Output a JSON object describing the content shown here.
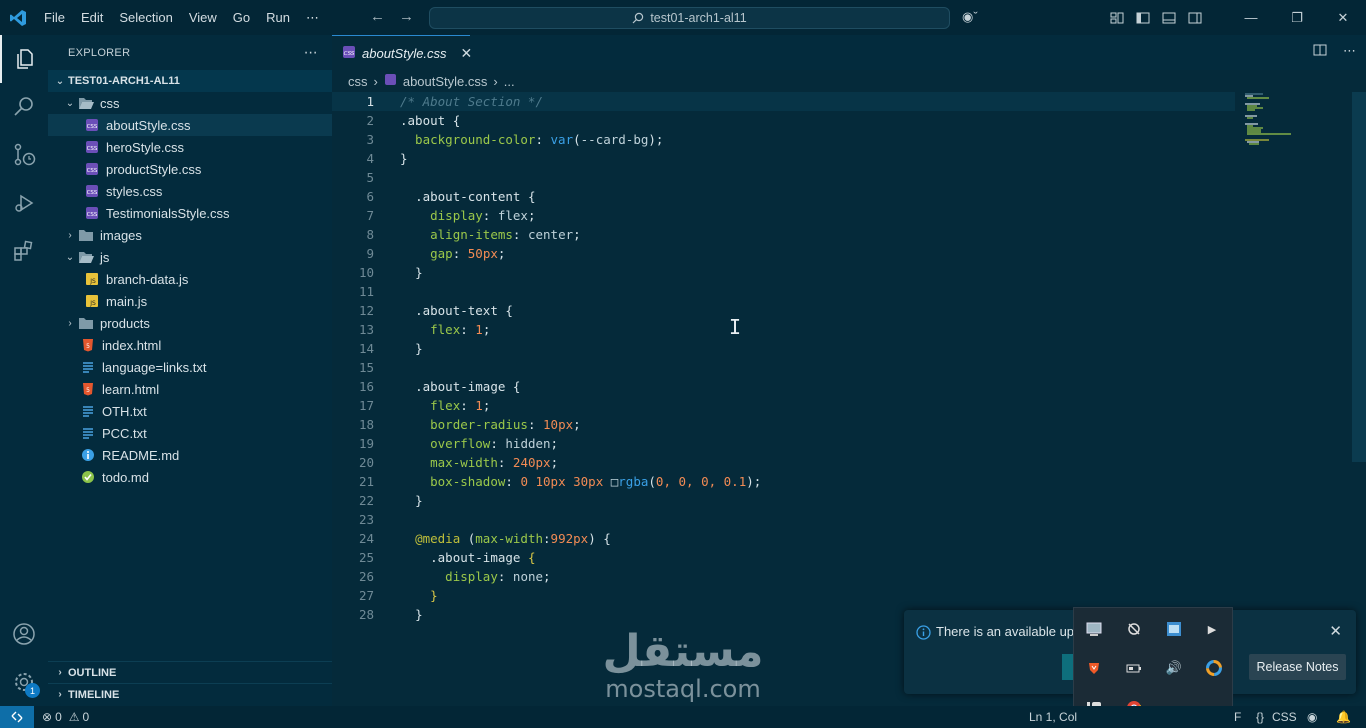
{
  "menu": [
    "File",
    "Edit",
    "Selection",
    "View",
    "Go",
    "Run",
    "⋯"
  ],
  "search": {
    "text": "test01-arch1-al11"
  },
  "sidebar": {
    "title": "EXPLORER",
    "more": "⋯",
    "root": "TEST01-ARCH1-AL11",
    "items": [
      {
        "label": "css",
        "type": "folder-open",
        "depth": 0
      },
      {
        "label": "aboutStyle.css",
        "type": "css",
        "depth": 1
      },
      {
        "label": "heroStyle.css",
        "type": "css",
        "depth": 1
      },
      {
        "label": "productStyle.css",
        "type": "css",
        "depth": 1
      },
      {
        "label": "styles.css",
        "type": "css",
        "depth": 1
      },
      {
        "label": "TestimonialsStyle.css",
        "type": "css",
        "depth": 1
      },
      {
        "label": "images",
        "type": "folder",
        "depth": 0
      },
      {
        "label": "js",
        "type": "folder-open",
        "depth": 0
      },
      {
        "label": "branch-data.js",
        "type": "js",
        "depth": 1
      },
      {
        "label": "main.js",
        "type": "js",
        "depth": 1
      },
      {
        "label": "products",
        "type": "folder",
        "depth": 0
      },
      {
        "label": "index.html",
        "type": "html",
        "depth": 0
      },
      {
        "label": "language=links.txt",
        "type": "txt",
        "depth": 0
      },
      {
        "label": "learn.html",
        "type": "html",
        "depth": 0
      },
      {
        "label": "OTH.txt",
        "type": "txt",
        "depth": 0
      },
      {
        "label": "PCC.txt",
        "type": "txt",
        "depth": 0
      },
      {
        "label": "README.md",
        "type": "info",
        "depth": 0
      },
      {
        "label": "todo.md",
        "type": "check",
        "depth": 0
      }
    ],
    "outline": "OUTLINE",
    "timeline": "TIMELINE"
  },
  "activity": {
    "badge": "1"
  },
  "editor": {
    "tab": "aboutStyle.css",
    "breadcrumb": [
      "css",
      "aboutStyle.css",
      "..."
    ],
    "lines": [
      [
        [
          "c-comment",
          "/* About Section */"
        ]
      ],
      [
        [
          "c-sel",
          ".about "
        ],
        [
          "c-punct",
          "{"
        ]
      ],
      [
        [
          "c-prop",
          "  background-color"
        ],
        [
          "c-punct",
          ": "
        ],
        [
          "c-fn",
          "var"
        ],
        [
          "c-punct",
          "("
        ],
        [
          "c-val",
          "--card-bg"
        ],
        [
          "c-punct",
          ");"
        ]
      ],
      [
        [
          "c-punct",
          "}"
        ]
      ],
      [],
      [
        [
          "c-sel",
          ".about-content "
        ],
        [
          "c-punct",
          "{"
        ]
      ],
      [
        [
          "c-prop",
          "  display"
        ],
        [
          "c-punct",
          ": "
        ],
        [
          "c-val",
          "flex"
        ],
        [
          "c-punct",
          ";"
        ]
      ],
      [
        [
          "c-prop",
          "  align-items"
        ],
        [
          "c-punct",
          ": "
        ],
        [
          "c-val",
          "center"
        ],
        [
          "c-punct",
          ";"
        ]
      ],
      [
        [
          "c-prop",
          "  gap"
        ],
        [
          "c-punct",
          ": "
        ],
        [
          "c-num",
          "50px"
        ],
        [
          "c-punct",
          ";"
        ]
      ],
      [
        [
          "c-punct",
          "}"
        ]
      ],
      [],
      [
        [
          "c-sel",
          ".about-text "
        ],
        [
          "c-punct",
          "{"
        ]
      ],
      [
        [
          "c-prop",
          "  flex"
        ],
        [
          "c-punct",
          ": "
        ],
        [
          "c-num",
          "1"
        ],
        [
          "c-punct",
          ";"
        ]
      ],
      [
        [
          "c-punct",
          "}"
        ]
      ],
      [],
      [
        [
          "c-sel",
          ".about-image "
        ],
        [
          "c-punct",
          "{"
        ]
      ],
      [
        [
          "c-prop",
          "  flex"
        ],
        [
          "c-punct",
          ": "
        ],
        [
          "c-num",
          "1"
        ],
        [
          "c-punct",
          ";"
        ]
      ],
      [
        [
          "c-prop",
          "  border-radius"
        ],
        [
          "c-punct",
          ": "
        ],
        [
          "c-num",
          "10px"
        ],
        [
          "c-punct",
          ";"
        ]
      ],
      [
        [
          "c-prop",
          "  overflow"
        ],
        [
          "c-punct",
          ": "
        ],
        [
          "c-val",
          "hidden"
        ],
        [
          "c-punct",
          ";"
        ]
      ],
      [
        [
          "c-prop",
          "  max-width"
        ],
        [
          "c-punct",
          ": "
        ],
        [
          "c-num",
          "240px"
        ],
        [
          "c-punct",
          ";"
        ]
      ],
      [
        [
          "c-prop",
          "  box-shadow"
        ],
        [
          "c-punct",
          ": "
        ],
        [
          "c-num",
          "0 10px 30px "
        ],
        [
          "c-val",
          "□"
        ],
        [
          "c-fn",
          "rgba"
        ],
        [
          "c-punct",
          "("
        ],
        [
          "c-num",
          "0, 0, 0, 0.1"
        ],
        [
          "c-punct",
          ");"
        ]
      ],
      [
        [
          "c-punct",
          "}"
        ]
      ],
      [],
      [
        [
          "c-media",
          "@media "
        ],
        [
          "c-punct",
          "("
        ],
        [
          "c-prop",
          "max-width"
        ],
        [
          "c-punct",
          ":"
        ],
        [
          "c-num",
          "992px"
        ],
        [
          "c-punct",
          ") {"
        ]
      ],
      [
        [
          "c-sel",
          "  .about-image "
        ],
        [
          "c-brace2",
          "{"
        ]
      ],
      [
        [
          "c-prop",
          "    display"
        ],
        [
          "c-punct",
          ": "
        ],
        [
          "c-val",
          "none"
        ],
        [
          "c-punct",
          ";"
        ]
      ],
      [
        [
          "c-brace2",
          "  }"
        ]
      ],
      [
        [
          "c-punct",
          "}"
        ]
      ]
    ]
  },
  "notification": {
    "message": "There is an available upd",
    "release_notes": "Release Notes",
    "close": "✕"
  },
  "statusbar": {
    "errors": "0",
    "warnings": "0",
    "position": "Ln 1, Col",
    "lang": "CSS",
    "lang_prefix": "F"
  },
  "watermark": {
    "arabic": "مستقل",
    "latin": "mostaql.com"
  },
  "colors": {
    "accent": "#2a8ad1",
    "background": "#052a3a",
    "sidebar": "#032b3d"
  }
}
